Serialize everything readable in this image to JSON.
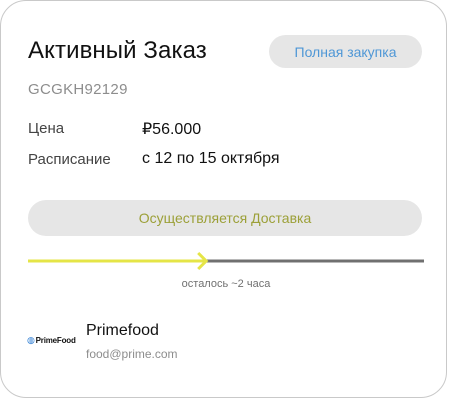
{
  "order": {
    "title": "Активный Заказ",
    "action_label": "Полная закупка",
    "id": "GCGKH92129"
  },
  "details": {
    "price_label": "Цена",
    "price_value": "₽56.000",
    "schedule_label": "Расписание",
    "schedule_value": "с 12 по 15 октября"
  },
  "status": {
    "label": "Осуществляется Доставка",
    "progress": 0.45,
    "remaining": "осталось ~2 часа",
    "colors": {
      "done": "#e5e547",
      "pending": "#707070"
    }
  },
  "vendor": {
    "logo_text": "PrimeFood",
    "logo_icon": "primefood-logo-icon",
    "name": "Primefood",
    "email": "food@prime.com"
  }
}
